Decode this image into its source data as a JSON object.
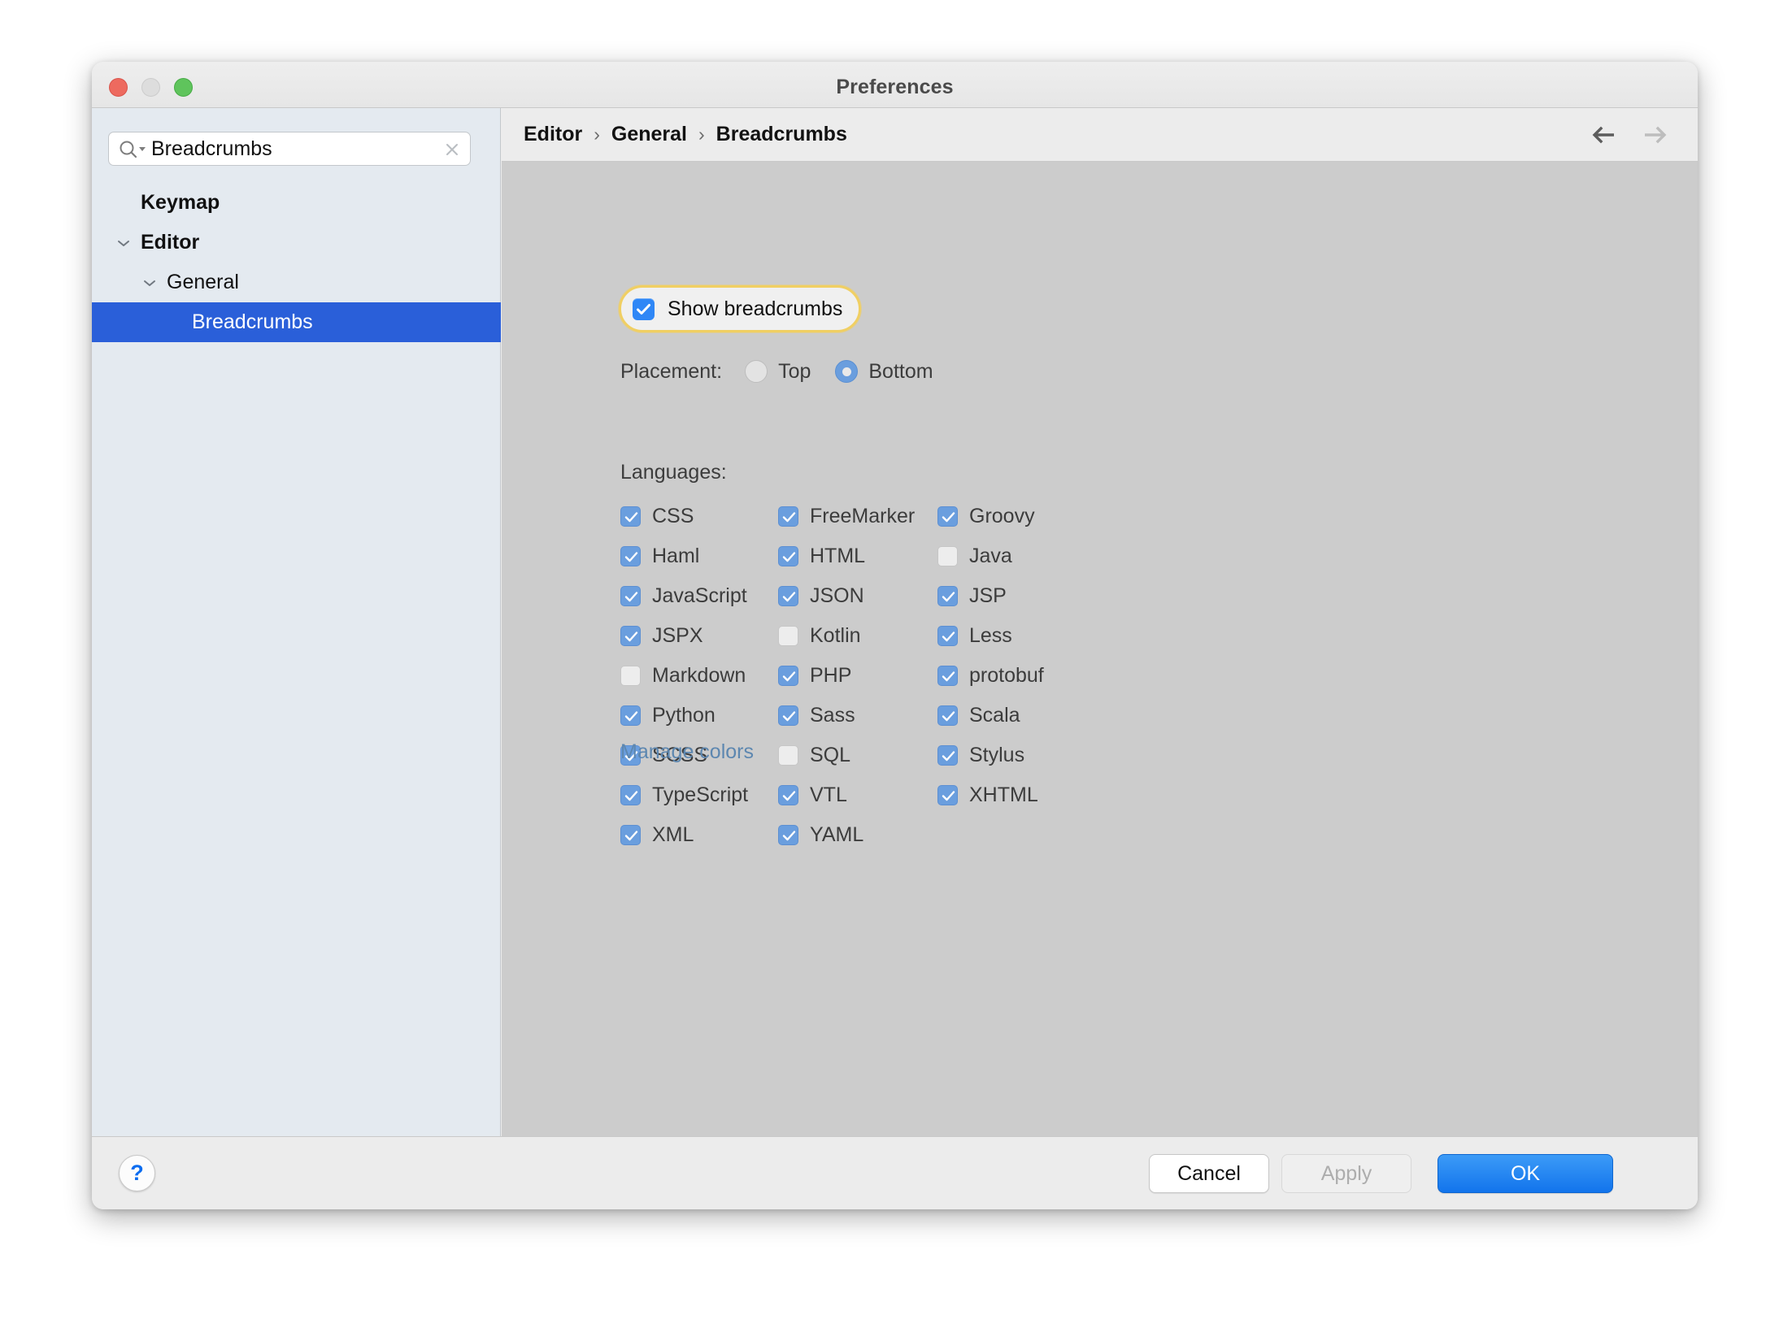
{
  "window": {
    "title": "Preferences",
    "traffic_lights": [
      "close",
      "minimize",
      "zoom"
    ]
  },
  "sidebar": {
    "search": {
      "value": "Breadcrumbs",
      "placeholder": "Search",
      "icon": "search-icon",
      "clear_icon": "clear-icon"
    },
    "tree": [
      {
        "label": "Keymap",
        "level": 0,
        "expandable": false,
        "expanded": false,
        "selected": false
      },
      {
        "label": "Editor",
        "level": 0,
        "expandable": true,
        "expanded": true,
        "selected": false
      },
      {
        "label": "General",
        "level": 1,
        "expandable": true,
        "expanded": true,
        "selected": false
      },
      {
        "label": "Breadcrumbs",
        "level": 2,
        "expandable": false,
        "expanded": false,
        "selected": true
      }
    ]
  },
  "content": {
    "breadcrumb": {
      "items": [
        "Editor",
        "General",
        "Breadcrumbs"
      ],
      "separator": "›"
    },
    "nav": {
      "back_icon": "arrow-left-icon",
      "forward_icon": "arrow-right-icon",
      "back_enabled": true,
      "forward_enabled": false
    },
    "show_breadcrumbs": {
      "label": "Show breadcrumbs",
      "checked": true,
      "focused": true
    },
    "placement": {
      "label": "Placement:",
      "options": [
        "Top",
        "Bottom"
      ],
      "selected": "Bottom"
    },
    "languages": {
      "label": "Languages:",
      "rows": [
        [
          {
            "label": "CSS",
            "checked": true
          },
          {
            "label": "FreeMarker",
            "checked": true
          },
          {
            "label": "Groovy",
            "checked": true
          }
        ],
        [
          {
            "label": "Haml",
            "checked": true
          },
          {
            "label": "HTML",
            "checked": true
          },
          {
            "label": "Java",
            "checked": false
          }
        ],
        [
          {
            "label": "JavaScript",
            "checked": true
          },
          {
            "label": "JSON",
            "checked": true
          },
          {
            "label": "JSP",
            "checked": true
          }
        ],
        [
          {
            "label": "JSPX",
            "checked": true
          },
          {
            "label": "Kotlin",
            "checked": false
          },
          {
            "label": "Less",
            "checked": true
          }
        ],
        [
          {
            "label": "Markdown",
            "checked": false
          },
          {
            "label": "PHP",
            "checked": true
          },
          {
            "label": "protobuf",
            "checked": true
          }
        ],
        [
          {
            "label": "Python",
            "checked": true
          },
          {
            "label": "Sass",
            "checked": true
          },
          {
            "label": "Scala",
            "checked": true
          }
        ],
        [
          {
            "label": "SCSS",
            "checked": true
          },
          {
            "label": "SQL",
            "checked": false
          },
          {
            "label": "Stylus",
            "checked": true
          }
        ],
        [
          {
            "label": "TypeScript",
            "checked": true
          },
          {
            "label": "VTL",
            "checked": true
          },
          {
            "label": "XHTML",
            "checked": true
          }
        ],
        [
          {
            "label": "XML",
            "checked": true
          },
          {
            "label": "YAML",
            "checked": true
          },
          {
            "label": "",
            "checked": null
          }
        ]
      ]
    },
    "manage_colors_link": "Manage colors"
  },
  "footer": {
    "help_label": "?",
    "cancel_label": "Cancel",
    "apply_label": "Apply",
    "apply_enabled": false,
    "ok_label": "OK"
  },
  "colors": {
    "selection_blue": "#2a5fd9",
    "checkbox_blue": "#6a9ede",
    "focus_checkbox_blue": "#2f87f6",
    "focus_ring_gold": "#f0cf63",
    "link_blue": "#5d87b0",
    "ok_button_blue": "#1274ec",
    "sidebar_bg": "#e4eaf0",
    "content_bg": "#cccccc"
  }
}
